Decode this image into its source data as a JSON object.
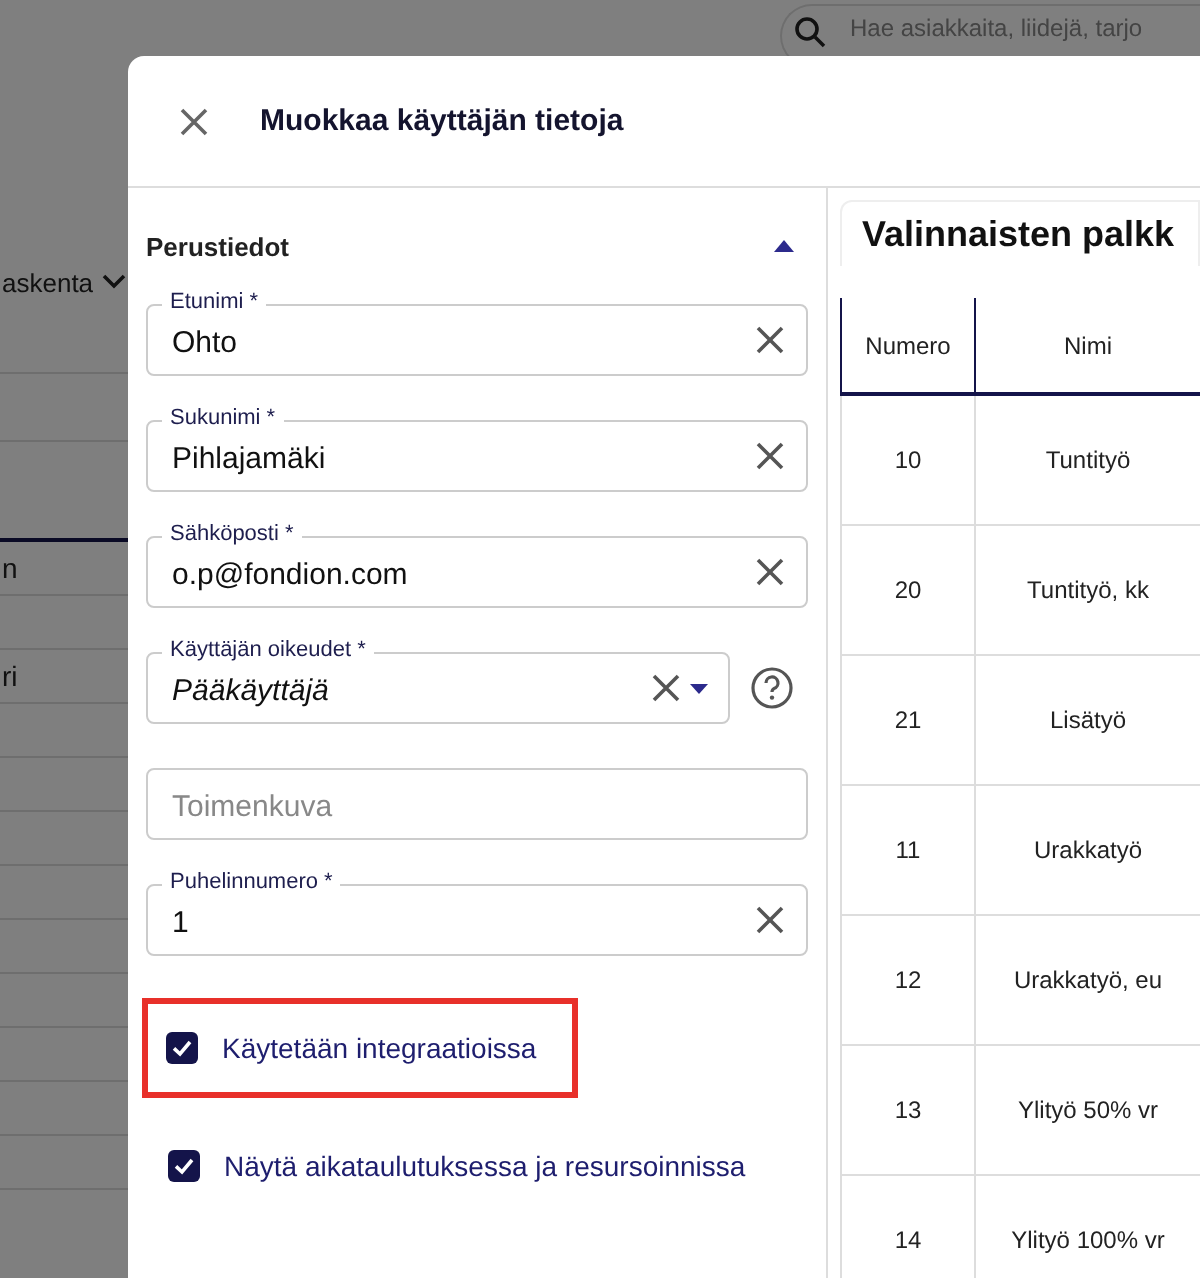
{
  "background": {
    "search": {
      "placeholder": "Hae asiakkaita, liidejä, tarjo"
    },
    "filter_label": "askenta",
    "rows": [
      {
        "text": "n"
      },
      {
        "text": "ri"
      }
    ]
  },
  "dialog": {
    "title": "Muokkaa käyttäjän tietoja",
    "section": {
      "title": "Perustiedot",
      "expanded": true
    },
    "fields": [
      {
        "kind": "text",
        "label": "Etunimi *",
        "value": "Ohto"
      },
      {
        "kind": "text",
        "label": "Sukunimi *",
        "value": "Pihlajamäki"
      },
      {
        "kind": "text",
        "label": "Sähköposti *",
        "value": "o.p@fondion.com"
      },
      {
        "kind": "select",
        "label": "Käyttäjän oikeudet *",
        "value": "Pääkäyttäjä"
      },
      {
        "kind": "text",
        "placeholder": "Toimenkuva"
      },
      {
        "kind": "text",
        "label": "Puhelinnumero *",
        "value": "1"
      }
    ],
    "checkboxes": [
      {
        "label": "Käytetään integraatioissa",
        "checked": true,
        "highlighted": true
      },
      {
        "label": "Näytä aikataulutuksessa ja resursoinnissa",
        "checked": true,
        "highlighted": false
      }
    ],
    "panel": {
      "title": "Valinnaisten palkk",
      "table": {
        "columns": [
          "Numero",
          "Nimi"
        ],
        "rows": [
          [
            "10",
            "Tuntityö"
          ],
          [
            "20",
            "Tuntityö, kk"
          ],
          [
            "21",
            "Lisätyö"
          ],
          [
            "11",
            "Urakkatyö"
          ],
          [
            "12",
            "Urakkatyö, eu"
          ],
          [
            "13",
            "Ylityö 50% vr"
          ],
          [
            "14",
            "Ylityö 100% vr"
          ]
        ]
      }
    }
  }
}
